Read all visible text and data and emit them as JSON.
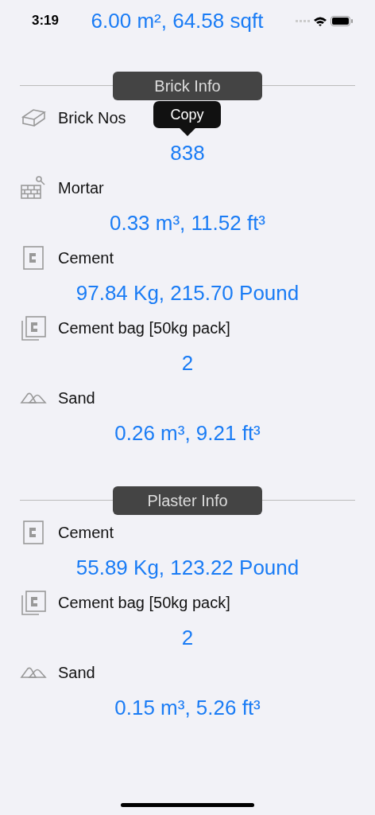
{
  "status_bar": {
    "time": "3:19",
    "title": "6.00 m², 64.58 sqft"
  },
  "sections": [
    {
      "title": "Brick Info",
      "items": [
        {
          "kind": "brick",
          "label": "Brick Nos",
          "value": "838"
        },
        {
          "kind": "mortar",
          "label": "Mortar",
          "value": "0.33 m³, 11.52 ft³"
        },
        {
          "kind": "cement",
          "label": "Cement",
          "value": "97.84 Kg, 215.70 Pound"
        },
        {
          "kind": "bag",
          "label": "Cement bag [50kg pack]",
          "value": "2"
        },
        {
          "kind": "sand",
          "label": "Sand",
          "value": "0.26 m³, 9.21 ft³"
        }
      ]
    },
    {
      "title": "Plaster Info",
      "items": [
        {
          "kind": "cement",
          "label": "Cement",
          "value": "55.89 Kg, 123.22 Pound"
        },
        {
          "kind": "bag",
          "label": "Cement bag [50kg pack]",
          "value": "2"
        },
        {
          "kind": "sand",
          "label": "Sand",
          "value": "0.15 m³, 5.26 ft³"
        }
      ]
    }
  ],
  "tooltip": {
    "text": "Copy"
  }
}
